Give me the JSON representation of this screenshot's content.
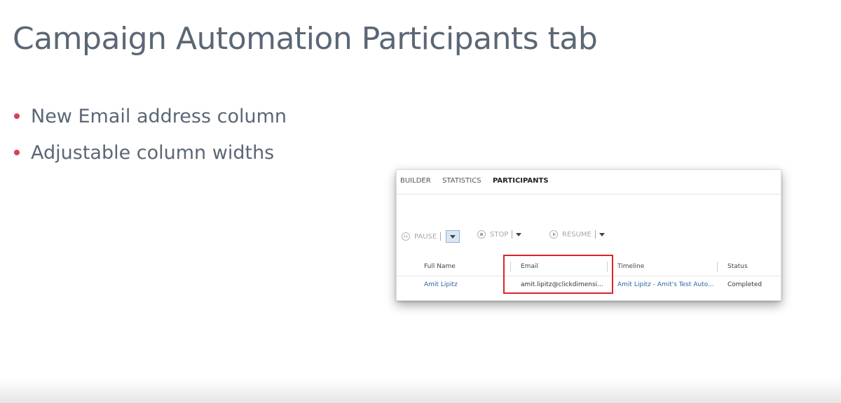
{
  "slide": {
    "title": "Campaign Automation Participants tab",
    "bullets": [
      "New Email address column",
      "Adjustable column widths"
    ],
    "bullet_color": "#d6405a",
    "text_color": "#5b6775"
  },
  "screenshot": {
    "tabs": [
      "BUILDER",
      "STATISTICS",
      "PARTICIPANTS"
    ],
    "active_tab": "PARTICIPANTS",
    "toolbar": {
      "pause_label": "PAUSE",
      "stop_label": "STOP",
      "resume_label": "RESUME"
    },
    "columns": [
      "Full Name",
      "Email",
      "Timeline",
      "Status"
    ],
    "rows": [
      {
        "full_name": "Amit Lipitz",
        "email": "amit.lipitz@clickdimensi...",
        "timeline": "Amit Lipitz - Amit's Test Auto...",
        "status": "Completed"
      }
    ],
    "highlight_color": "#d9262b",
    "link_color": "#2e5fa8"
  }
}
